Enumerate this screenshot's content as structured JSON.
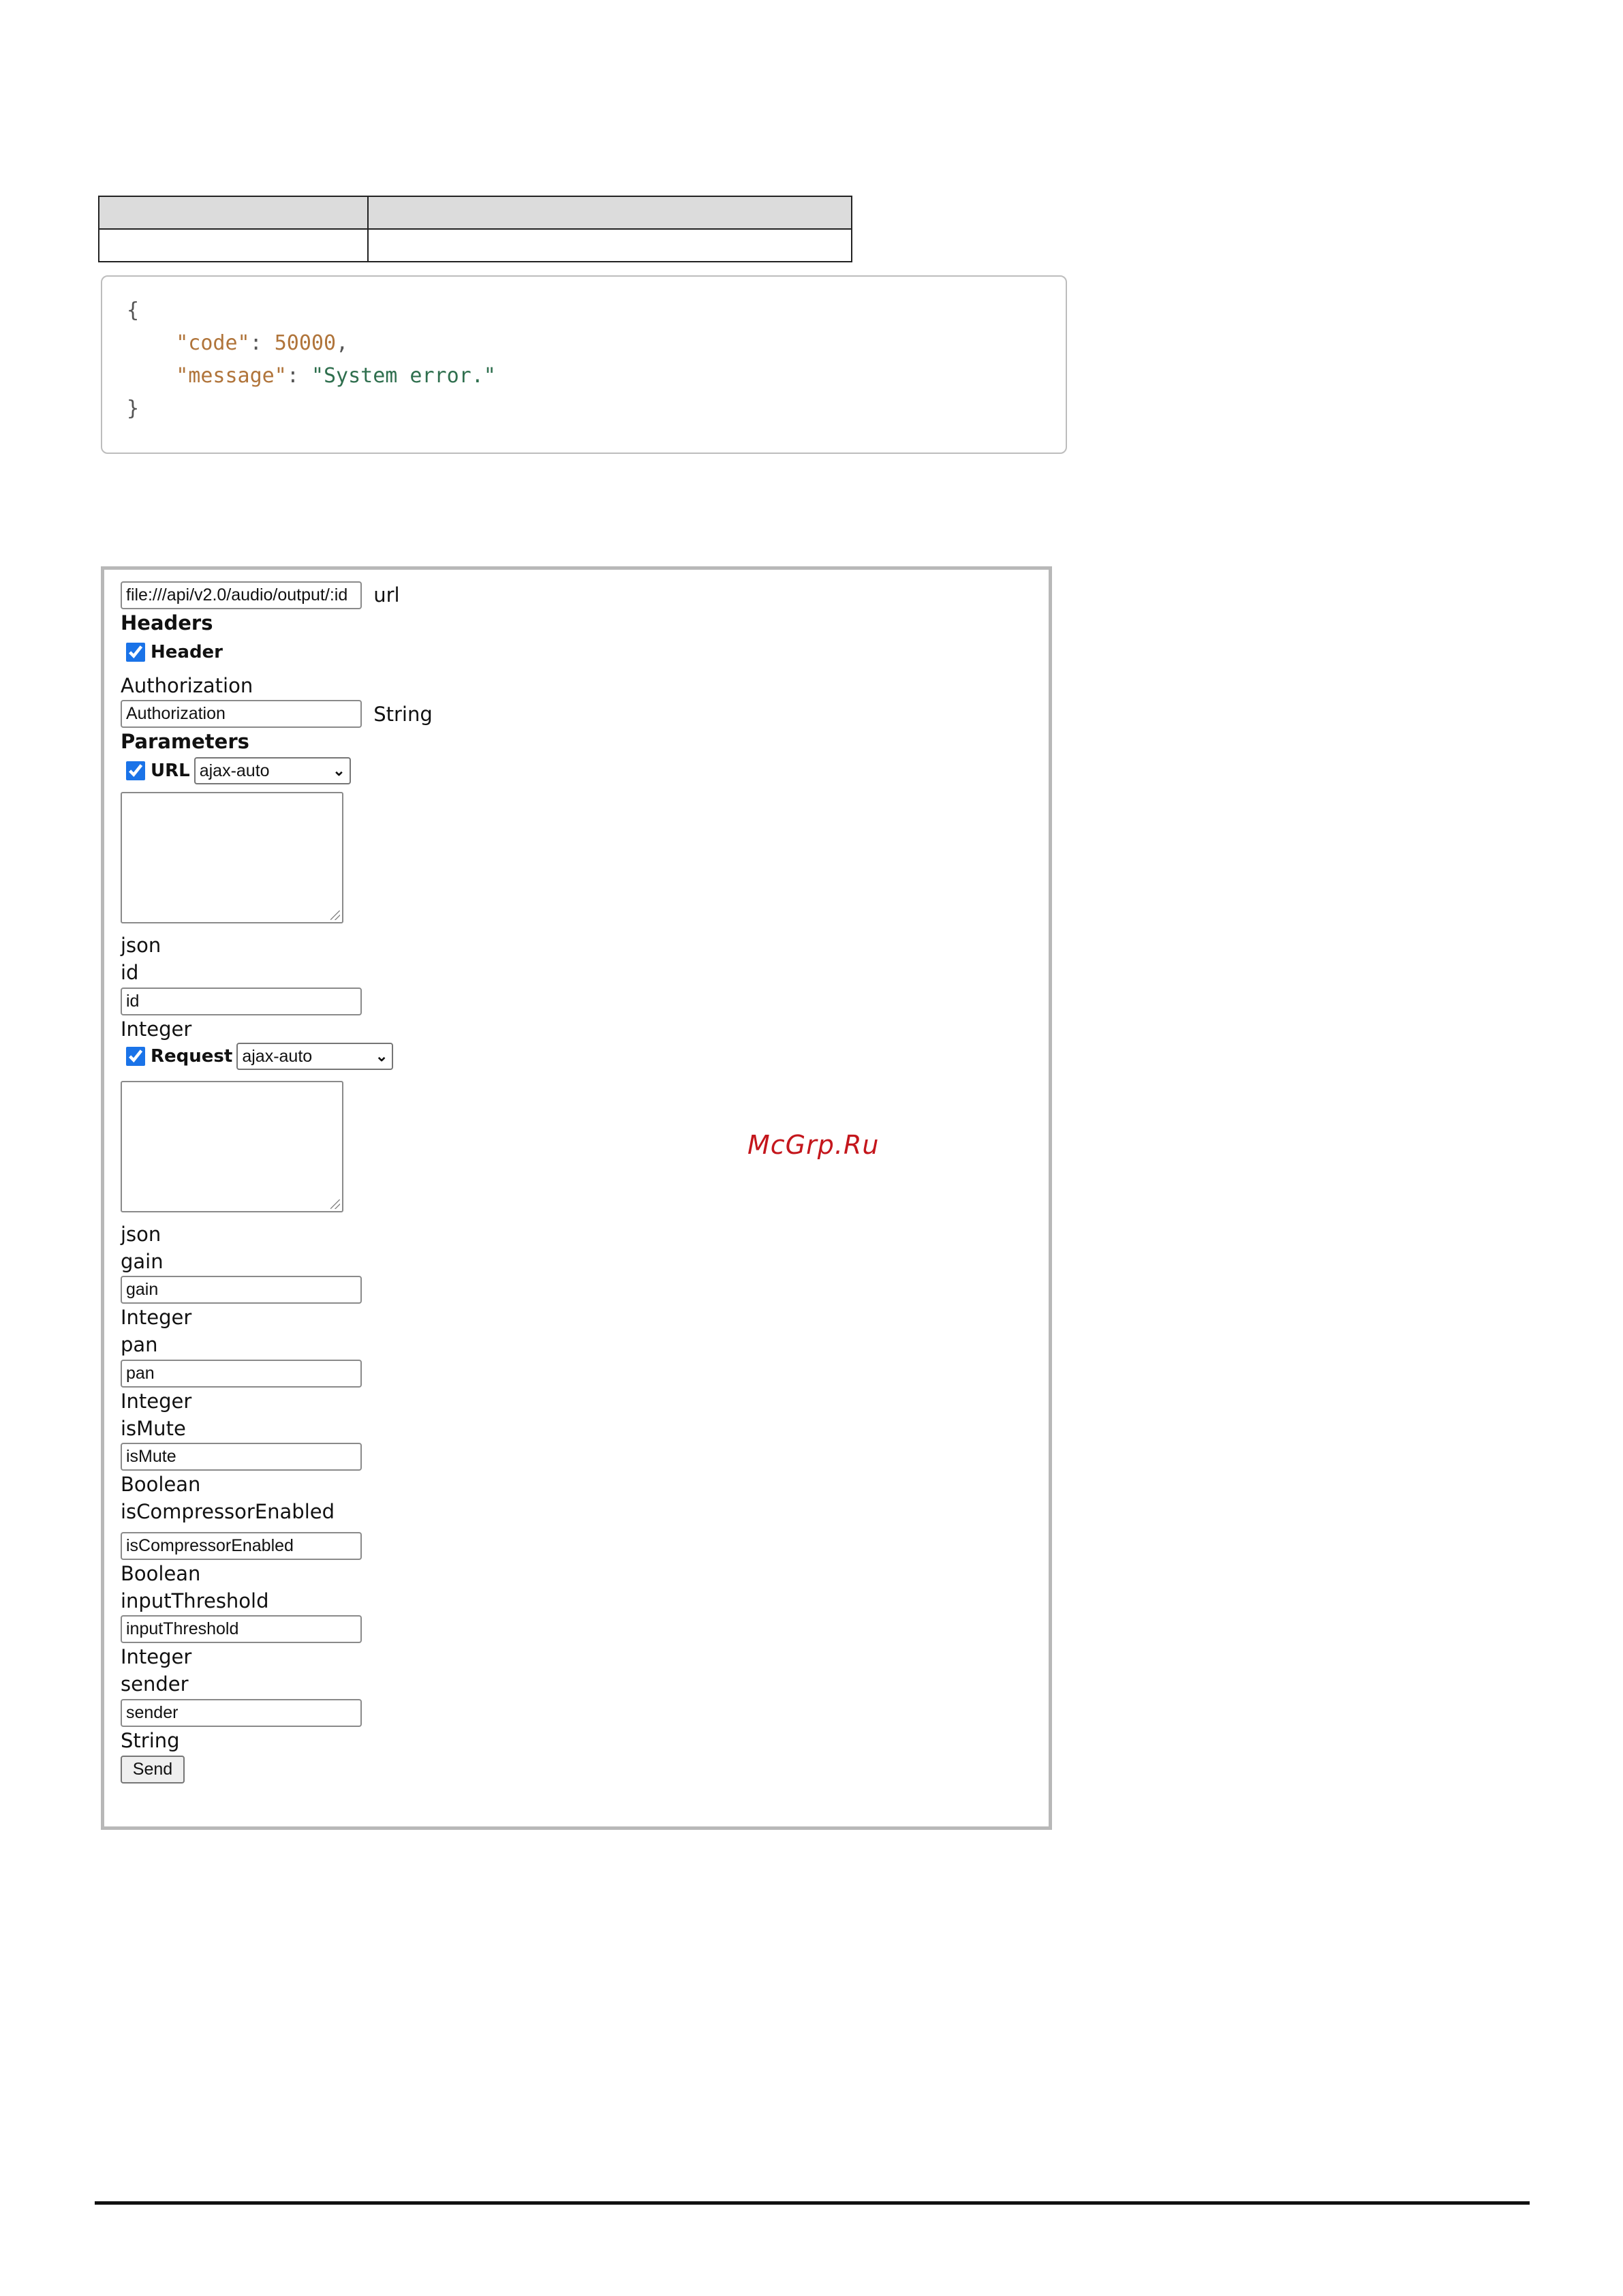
{
  "json_response": {
    "open_brace": "{",
    "code_key": "\"code\"",
    "code_value": "50000",
    "message_key": "\"message\"",
    "message_value": "\"System error.\"",
    "close_brace": "}"
  },
  "form": {
    "url_value": "file:///api/v2.0/audio/output/:id",
    "url_label": "url",
    "headers_title": "Headers",
    "header_checkbox_label": "Header",
    "header_checked": true,
    "authorization_label": "Authorization",
    "authorization_placeholder": "Authorization",
    "authorization_type": "String",
    "parameters_title": "Parameters",
    "url_checkbox_label": "URL",
    "url_checked": true,
    "url_select_value": "ajax-auto",
    "url_textarea_type": "json",
    "id_label": "id",
    "id_placeholder": "id",
    "id_type": "Integer",
    "request_checkbox_label": "Request",
    "request_checked": true,
    "request_select_value": "ajax-auto",
    "request_textarea_type": "json",
    "gain_label": "gain",
    "gain_placeholder": "gain",
    "gain_type": "Integer",
    "pan_label": "pan",
    "pan_placeholder": "pan",
    "pan_type": "Integer",
    "ismute_label": "isMute",
    "ismute_placeholder": "isMute",
    "ismute_type": "Boolean",
    "iscompressor_label": "isCompressorEnabled",
    "iscompressor_placeholder": "isCompressorEnabled",
    "iscompressor_type": "Boolean",
    "inputthreshold_label": "inputThreshold",
    "inputthreshold_placeholder": "inputThreshold",
    "inputthreshold_type": "Integer",
    "sender_label": "sender",
    "sender_placeholder": "sender",
    "sender_type": "String",
    "send_button_label": "Send"
  },
  "watermark": "McGrp.Ru",
  "colors": {
    "watermark": "#c4161c",
    "json_key": "#b0743a",
    "json_string": "#2f6f4e",
    "checkbox": "#1a73e8"
  }
}
